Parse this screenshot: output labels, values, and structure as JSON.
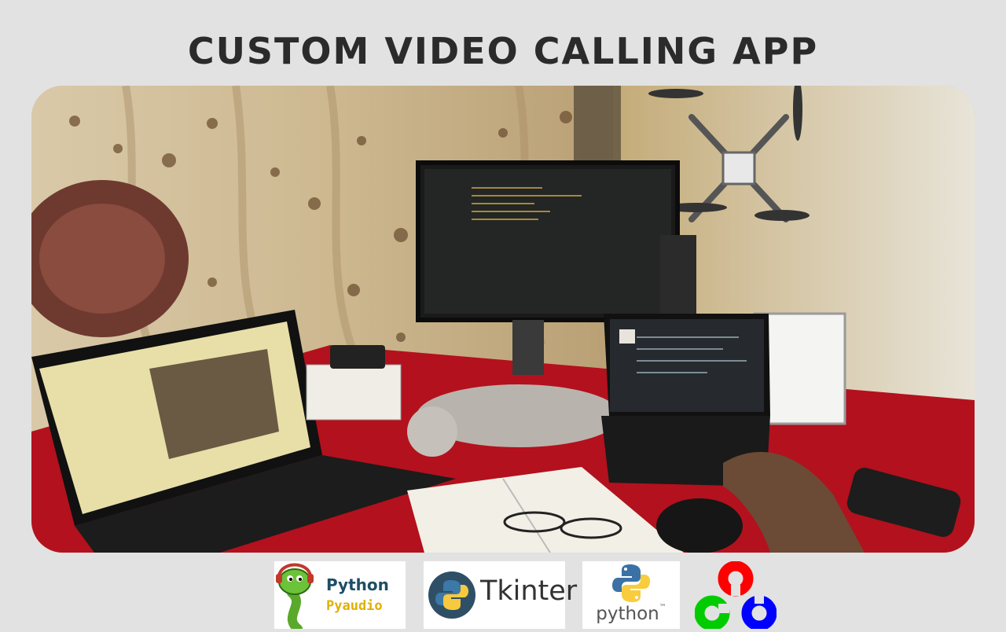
{
  "page": {
    "title": "CUSTOM VIDEO CALLING APP",
    "background_color": "#e2e2e2",
    "title_color": "#2b2b2b"
  },
  "video_frame": {
    "content": "live video feed"
  },
  "logos": {
    "pyaudio": {
      "line1": "Python",
      "line2": "Pyaudio",
      "icon": "snake-headphones-icon"
    },
    "tkinter": {
      "label": "Tkinter",
      "icon": "python-logo-icon"
    },
    "python": {
      "label": "python",
      "trademark": "™",
      "icon": "python-logo-icon"
    },
    "opencv": {
      "icon": "opencv-logo-icon",
      "colors": [
        "#ff0000",
        "#00cc00",
        "#0000ff"
      ]
    }
  }
}
